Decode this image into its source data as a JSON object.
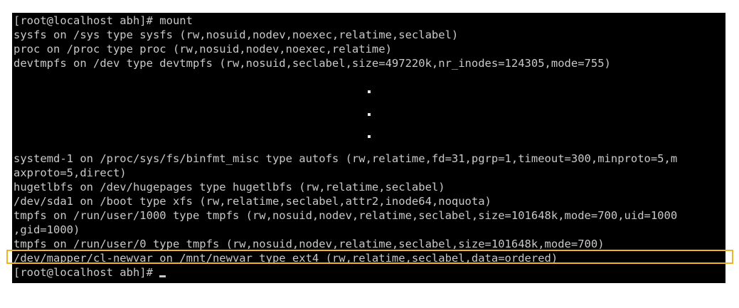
{
  "terminal": {
    "top_lines": [
      "[root@localhost abh]# mount",
      "sysfs on /sys type sysfs (rw,nosuid,nodev,noexec,relatime,seclabel)",
      "proc on /proc type proc (rw,nosuid,nodev,noexec,relatime)",
      "devtmpfs on /dev type devtmpfs (rw,nosuid,seclabel,size=497220k,nr_inodes=124305,mode=755)"
    ],
    "bottom_lines": [
      "systemd-1 on /proc/sys/fs/binfmt_misc type autofs (rw,relatime,fd=31,pgrp=1,timeout=300,minproto=5,m",
      "axproto=5,direct)",
      "hugetlbfs on /dev/hugepages type hugetlbfs (rw,relatime,seclabel)",
      "/dev/sda1 on /boot type xfs (rw,relatime,seclabel,attr2,inode64,noquota)",
      "tmpfs on /run/user/1000 type tmpfs (rw,nosuid,nodev,relatime,seclabel,size=101648k,mode=700,uid=1000",
      ",gid=1000)",
      "tmpfs on /run/user/0 type tmpfs (rw,nosuid,nodev,relatime,seclabel,size=101648k,mode=700)",
      "/dev/mapper/cl-newvar on /mnt/newvar type ext4 (rw,relatime,seclabel,data=ordered)"
    ],
    "prompt": "[root@localhost abh]# "
  },
  "colors": {
    "terminal_bg": "#000000",
    "terminal_text": "#c9c9c9",
    "highlight_border": "#f0b323"
  }
}
